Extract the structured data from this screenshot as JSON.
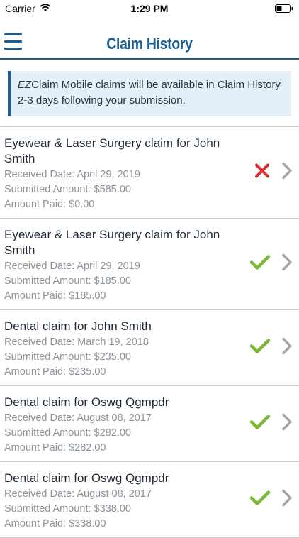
{
  "status_bar": {
    "carrier": "Carrier",
    "time": "1:29 PM"
  },
  "nav": {
    "title": "Claim History",
    "menu_icon": "hamburger-icon"
  },
  "notice": {
    "em": "EZ",
    "text": "Claim Mobile claims will be available in Claim History 2-3 days following your submission."
  },
  "colors": {
    "accent": "#1b5e93",
    "approved": "#7ab835",
    "denied": "#d62f2f",
    "notice_bg": "#e4eff8"
  },
  "claims": [
    {
      "title": "Eyewear & Laser Surgery claim for John Smith",
      "received": "Received Date: April 29, 2019",
      "submitted": "Submitted Amount: $585.00",
      "paid": "Amount Paid: $0.00",
      "status": "denied"
    },
    {
      "title": "Eyewear & Laser Surgery claim for John Smith",
      "received": "Received Date: April 29, 2019",
      "submitted": "Submitted Amount: $185.00",
      "paid": "Amount Paid: $185.00",
      "status": "approved"
    },
    {
      "title": "Dental claim for John Smith",
      "received": "Received Date: March 19, 2018",
      "submitted": "Submitted Amount: $235.00",
      "paid": "Amount Paid: $235.00",
      "status": "approved"
    },
    {
      "title": "Dental claim for Oswg Qgmpdr",
      "received": "Received Date: August 08, 2017",
      "submitted": "Submitted Amount: $282.00",
      "paid": "Amount Paid: $282.00",
      "status": "approved"
    },
    {
      "title": "Dental claim for Oswg Qgmpdr",
      "received": "Received Date: August 08, 2017",
      "submitted": "Submitted Amount: $338.00",
      "paid": "Amount Paid: $338.00",
      "status": "approved"
    }
  ]
}
